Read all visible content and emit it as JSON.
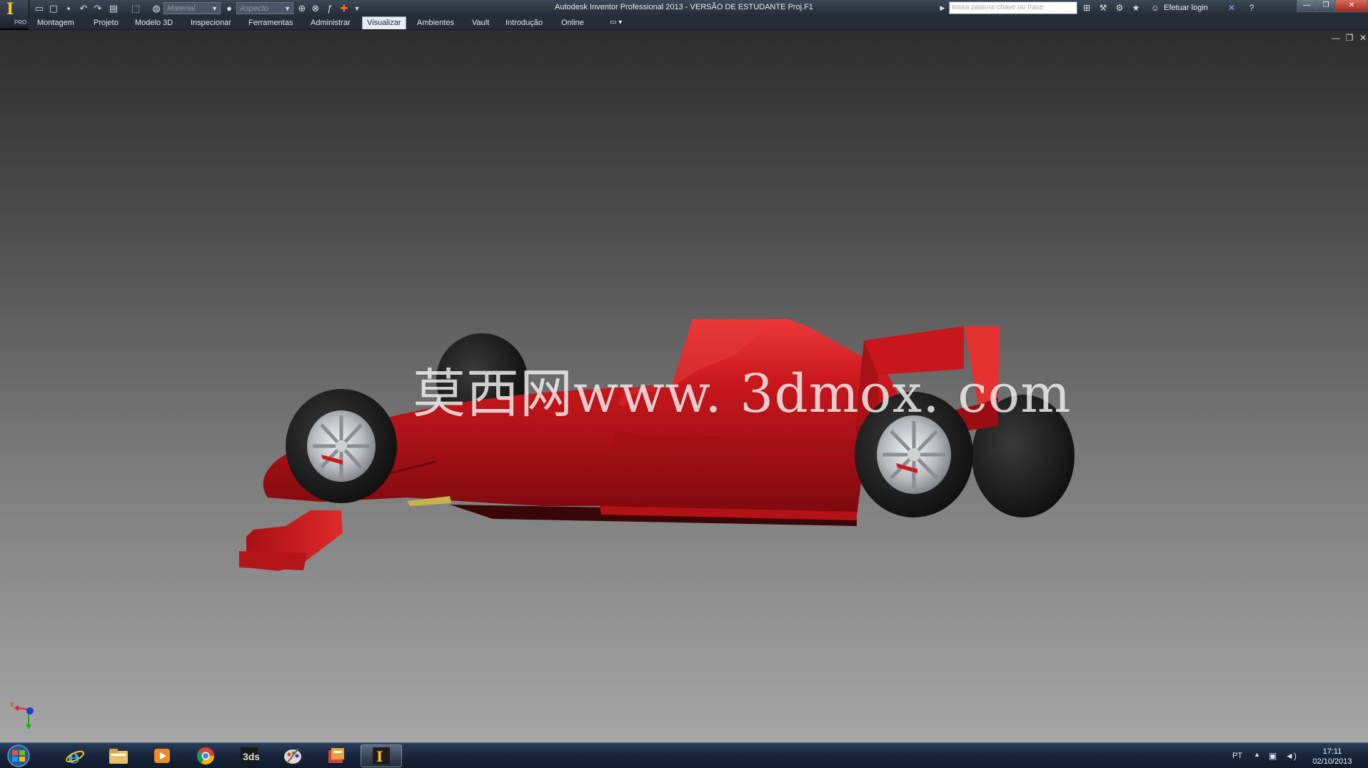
{
  "window": {
    "title": "Autodesk Inventor Professional 2013 - VERSÃO DE ESTUDANTE   Proj.F1"
  },
  "app_menu": {
    "badge": "PRO"
  },
  "quick_access": {
    "material_placeholder": "Material",
    "appearance_placeholder": "Aspecto"
  },
  "help": {
    "search_placeholder": "Insira palavra chave ou frase",
    "login_label": "Efetuar login"
  },
  "ribbon": {
    "tabs": [
      {
        "label": "Montagem"
      },
      {
        "label": "Projeto"
      },
      {
        "label": "Modelo 3D"
      },
      {
        "label": "Inspecionar"
      },
      {
        "label": "Ferramentas"
      },
      {
        "label": "Administrar"
      },
      {
        "label": "Visualizar",
        "active": true
      },
      {
        "label": "Ambientes"
      },
      {
        "label": "Vault"
      },
      {
        "label": "Introdução"
      },
      {
        "label": "Online"
      }
    ]
  },
  "viewport": {
    "watermark": "莫西网www. 3dmox. com",
    "model": "formula-1-car",
    "colors": {
      "body": "#c8161c",
      "tire": "#1a1a1a",
      "rim": "#b9bcc0"
    },
    "triad": {
      "x_label": "X"
    }
  },
  "taskbar": {
    "apps": [
      {
        "name": "internet-explorer-icon"
      },
      {
        "name": "file-explorer-icon"
      },
      {
        "name": "media-player-icon"
      },
      {
        "name": "chrome-icon"
      },
      {
        "name": "3ds-max-icon"
      },
      {
        "name": "paint-icon"
      },
      {
        "name": "app-icon"
      },
      {
        "name": "inventor-icon",
        "active": true
      }
    ],
    "language": "PT",
    "time": "17:11",
    "date": "02/10/2013"
  }
}
